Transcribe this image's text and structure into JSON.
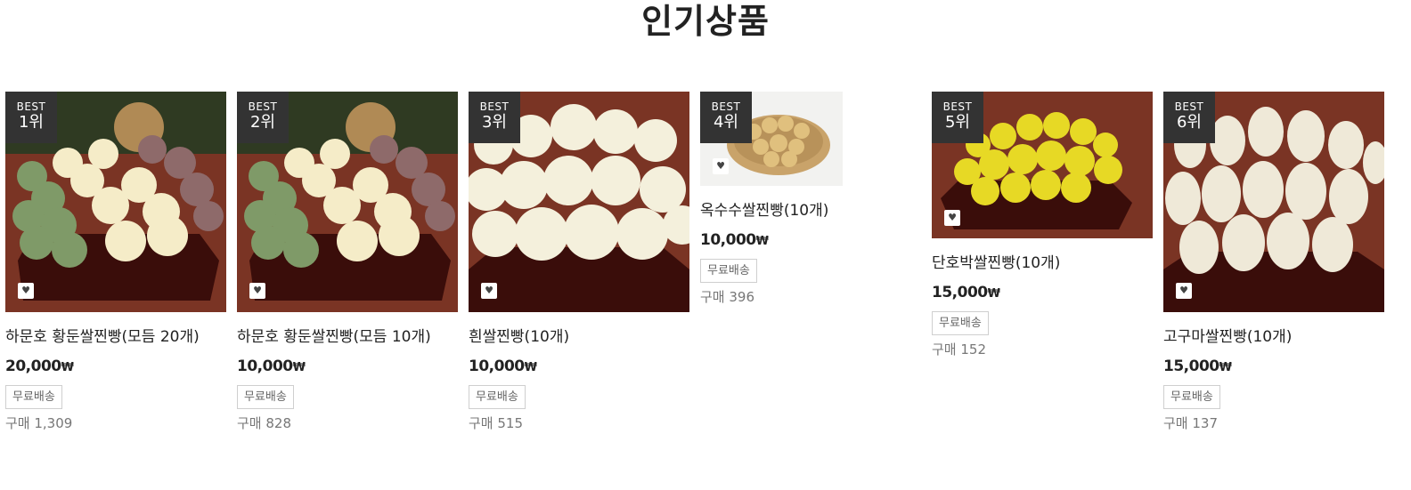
{
  "section": {
    "title": "인기상품"
  },
  "labels": {
    "best": "BEST",
    "wish_icon": "♥"
  },
  "products": [
    {
      "rank": "1위",
      "name": "하문호 황둔쌀찐빵(모듬 20개)",
      "price": "20,000",
      "currency": "₩",
      "shipping": "무료배송",
      "sold": "구매 1,309"
    },
    {
      "rank": "2위",
      "name": "하문호 황둔쌀찐빵(모듬 10개)",
      "price": "10,000",
      "currency": "₩",
      "shipping": "무료배송",
      "sold": "구매 828"
    },
    {
      "rank": "3위",
      "name": "흰쌀찐빵(10개)",
      "price": "10,000",
      "currency": "₩",
      "shipping": "무료배송",
      "sold": "구매 515"
    },
    {
      "rank": "4위",
      "name": "옥수수쌀찐빵(10개)",
      "price": "10,000",
      "currency": "₩",
      "shipping": "무료배송",
      "sold": "구매 396"
    },
    {
      "rank": "5위",
      "name": "단호박쌀찐빵(10개)",
      "price": "15,000",
      "currency": "₩",
      "shipping": "무료배송",
      "sold": "구매 152"
    },
    {
      "rank": "6위",
      "name": "고구마쌀찐빵(10개)",
      "price": "15,000",
      "currency": "₩",
      "shipping": "무료배송",
      "sold": "구매 137"
    }
  ],
  "colors": {
    "badge_bg": "#333333",
    "tray": "#3a0d0a",
    "mat": "#7a3424"
  }
}
